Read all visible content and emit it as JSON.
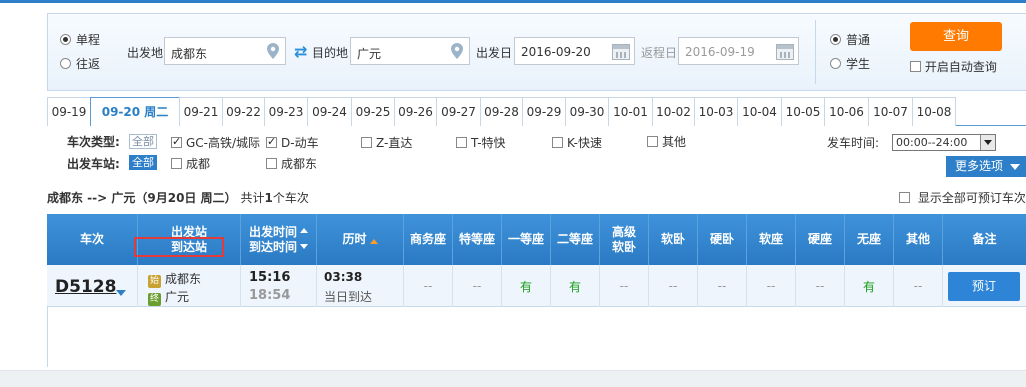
{
  "search": {
    "trip_one_way": "单程",
    "trip_round": "往返",
    "from_label": "出发地",
    "from_value": "成都东",
    "to_label": "目的地",
    "to_value": "广元",
    "depart_label": "出发日",
    "depart_value": "2016-09-20",
    "return_label": "返程日",
    "return_value": "2016-09-19",
    "ticket_normal": "普通",
    "ticket_student": "学生",
    "query_button": "查询",
    "auto_query": "开启自动查询"
  },
  "date_tabs": [
    "09-19",
    "09-20 周二",
    "09-21",
    "09-22",
    "09-23",
    "09-24",
    "09-25",
    "09-26",
    "09-27",
    "09-28",
    "09-29",
    "09-30",
    "10-01",
    "10-02",
    "10-03",
    "10-04",
    "10-05",
    "10-06",
    "10-07",
    "10-08"
  ],
  "active_date_index": 1,
  "filters": {
    "train_type_label": "车次类型:",
    "all": "全部",
    "types": [
      "GC-高铁/城际",
      "D-动车",
      "Z-直达",
      "T-特快",
      "K-快速",
      "其他"
    ],
    "depart_station_label": "出发车站:",
    "stations": [
      "成都",
      "成都东"
    ],
    "depart_time_label": "发车时间:",
    "depart_time_value": "00:00--24:00",
    "more_options": "更多选项"
  },
  "summary": {
    "route": "成都东 --> 广元（9月20日  周二）",
    "count_prefix": "共计",
    "count": "1",
    "count_suffix": "个车次",
    "show_all": "显示全部可预订车次"
  },
  "table": {
    "headers": {
      "train": "车次",
      "stations_1": "出发站",
      "stations_2": "到达站",
      "times_1": "出发时间",
      "times_2": "到达时间",
      "duration": "历时",
      "business": "商务座",
      "special": "特等座",
      "first": "一等座",
      "second": "二等座",
      "soft_sleeper_adv_1": "高级",
      "soft_sleeper_adv_2": "软卧",
      "soft_sleeper": "软卧",
      "hard_sleeper": "硬卧",
      "soft_seat": "软座",
      "hard_seat": "硬座",
      "no_seat": "无座",
      "other": "其他",
      "note": "备注"
    },
    "row": {
      "train_no": "D5128",
      "from_badge": "始",
      "from_station": "成都东",
      "to_badge": "终",
      "to_station": "广元",
      "depart_time": "15:16",
      "arrive_time": "18:54",
      "duration": "03:38",
      "arrive_day": "当日到达",
      "business": "--",
      "special": "--",
      "first": "有",
      "second": "有",
      "soft_sleeper_adv": "--",
      "soft_sleeper": "--",
      "hard_sleeper": "--",
      "soft_seat": "--",
      "hard_seat": "--",
      "no_seat": "有",
      "other": "--",
      "book_button": "预订"
    }
  }
}
